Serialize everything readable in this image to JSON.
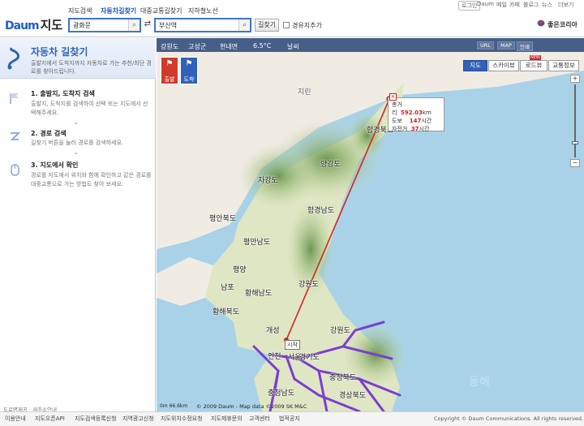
{
  "header": {
    "logo_daum": "Daum",
    "logo_title": "지도",
    "tabs": [
      "지도검색",
      "자동차길찾기",
      "대중교통길찾기",
      "지하철노선"
    ],
    "util_links": [
      "로그인",
      "Daum",
      "메일",
      "카페",
      "블로그",
      "뉴스",
      "더보기"
    ],
    "start_value": "광화문",
    "end_value": "부산역",
    "find_button": "길찾기",
    "waypoint_label": "경유지추가",
    "region_label": "좋은코리아"
  },
  "panel": {
    "title": "자동차 길찾기",
    "desc": "출발지에서 도착지까지 자동차로 가는 추천/최단 경로를 찾아드립니다.",
    "steps": [
      {
        "title": "1. 출발지, 도착지 검색",
        "desc": "출발지, 도착지를 검색하여 선택 또는 지도에서 선택해주세요."
      },
      {
        "title": "2. 경로 검색",
        "desc": "길찾기 버튼을 눌러 경로를 검색하세요."
      },
      {
        "title": "3. 지도에서 확인",
        "desc": "경로를 지도에서 위치와 함께 확인하고 같은 경로를 대중교통으로 가는 방법도 찾아 보세요."
      }
    ],
    "bottom_note": "도로명제공 · 새주소안내"
  },
  "map": {
    "toolbar": [
      "강원도",
      "고성군",
      "현내면",
      "6.5°C",
      "날씨"
    ],
    "right_buttons": [
      "URL",
      "MAP",
      "인쇄"
    ],
    "start_button": "출발",
    "arrive_button": "도착",
    "view_tabs": [
      "지도",
      "스카이뷰",
      "로드뷰",
      "교통정보"
    ],
    "new_badge": "NEW",
    "places": [
      "지린",
      "함경북도",
      "양강도",
      "자강도",
      "함경남도",
      "평안북도",
      "평안남도",
      "평양",
      "남포",
      "황해남도",
      "황해북도",
      "강원도",
      "개성",
      "인천",
      "서울",
      "경기도",
      "강원도",
      "충청북도",
      "충청남도",
      "경상북도",
      "동해"
    ],
    "info_box": {
      "rows": [
        {
          "label": "총거리",
          "value": "592.03",
          "unit": "km"
        },
        {
          "label": "도보",
          "value": "147",
          "unit": "시간"
        },
        {
          "label": "자전거",
          "value": "37",
          "unit": "시간"
        }
      ]
    },
    "start_label": "시작",
    "scale_label": "0m    66.6km",
    "map_copyright": "© 2009 Daum - Map data ©2009 SK M&C"
  },
  "footer": {
    "links": [
      "이용안내",
      "지도오픈API",
      "지도검색등록신청",
      "지역광고신청",
      "지도위치수정요청",
      "지도제휴문의",
      "고객센터",
      "법적공지"
    ],
    "copyright": "Copyright © Daum Communications. All rights reserved."
  },
  "colors": {
    "accent": "#2f62b8",
    "route": "#d02525",
    "roads": "#7a3fd0"
  }
}
